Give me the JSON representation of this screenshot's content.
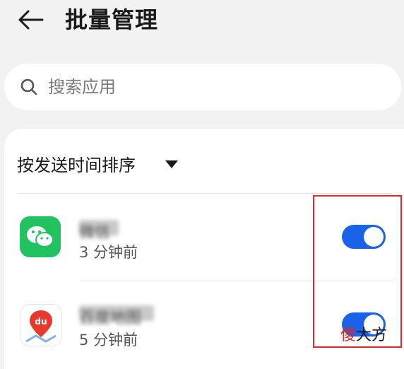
{
  "header": {
    "title": "批量管理"
  },
  "search": {
    "placeholder": "搜索应用"
  },
  "sort": {
    "label": "按发送时间排序"
  },
  "apps": [
    {
      "name": "微信",
      "time": "3 分钟前",
      "enabled": true,
      "icon": "wechat-icon"
    },
    {
      "name": "百度地图",
      "time": "5 分钟前",
      "enabled": true,
      "icon": "baidu-map-icon"
    }
  ],
  "watermark": {
    "part1": "傻",
    "part2": "大方"
  },
  "colors": {
    "accent": "#1a62e8",
    "highlight": "#e02828",
    "wechat": "#21c25f"
  }
}
